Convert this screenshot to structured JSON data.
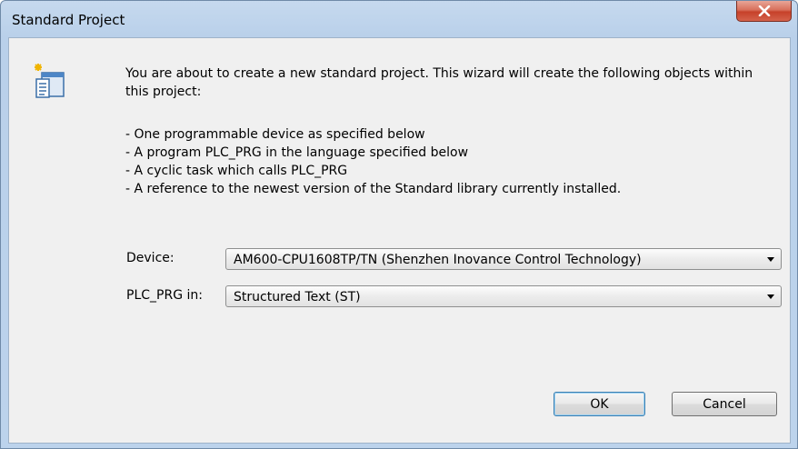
{
  "window": {
    "title": "Standard Project"
  },
  "dialog": {
    "intro": "You are about to create a new standard project. This wizard will create the following objects within this project:",
    "bullets": [
      "- One programmable device as specified below",
      "- A program PLC_PRG in the language specified below",
      "- A cyclic task which calls PLC_PRG",
      "- A reference to the newest version of the Standard library currently installed."
    ],
    "device": {
      "label": "Device:",
      "value": "AM600-CPU1608TP/TN (Shenzhen Inovance Control Technology)"
    },
    "plc_prg": {
      "label": "PLC_PRG in:",
      "value": "Structured Text (ST)"
    },
    "buttons": {
      "ok": "OK",
      "cancel": "Cancel"
    }
  },
  "icons": {
    "app": "project-wizard-icon",
    "close": "close-icon",
    "dropdown": "chevron-down-icon"
  },
  "colors": {
    "title_bar": "#bcd3ec",
    "close_button": "#c6412a",
    "client_bg": "#f0f0f0",
    "default_button_border": "#3c7fb1"
  }
}
